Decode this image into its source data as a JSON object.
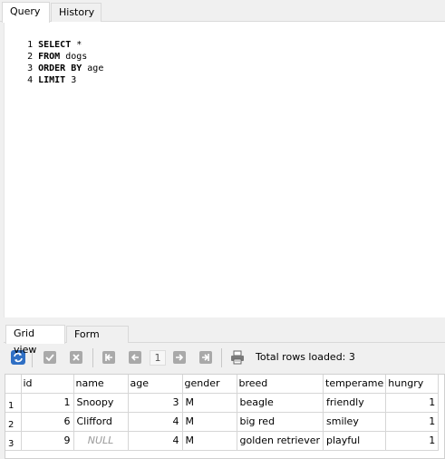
{
  "top_tabs": [
    {
      "label": "Query",
      "active": true
    },
    {
      "label": "History",
      "active": false
    }
  ],
  "editor": {
    "lines": [
      {
        "num": "1",
        "kw": "SELECT",
        "rest": " *"
      },
      {
        "num": "2",
        "kw": "FROM",
        "rest": " dogs"
      },
      {
        "num": "3",
        "kw": "ORDER BY",
        "rest": " age"
      },
      {
        "num": "4",
        "kw": "LIMIT",
        "rest": " 3"
      }
    ]
  },
  "bottom_tabs": [
    {
      "label": "Grid view",
      "active": true
    },
    {
      "label": "Form view",
      "active": false
    }
  ],
  "toolbar": {
    "icons": [
      "refresh-icon",
      "commit-check-icon",
      "rollback-x-icon",
      "first-page-icon",
      "prev-page-icon",
      "next-page-icon",
      "last-page-icon",
      "print-icon"
    ],
    "page": "1",
    "total_label": "Total rows loaded: 3"
  },
  "grid": {
    "columns": [
      "id",
      "name",
      "age",
      "gender",
      "breed",
      "temperame",
      "hungry"
    ],
    "rows": [
      {
        "rn": "1",
        "id": "1",
        "name": "Snoopy",
        "age": "3",
        "gender": "M",
        "breed": "beagle",
        "temperament": "friendly",
        "hungry": "1"
      },
      {
        "rn": "2",
        "id": "6",
        "name": "Clifford",
        "age": "4",
        "gender": "M",
        "breed": "big red",
        "temperament": "smiley",
        "hungry": "1"
      },
      {
        "rn": "3",
        "id": "9",
        "name": "NULL",
        "age": "4",
        "gender": "M",
        "breed": "golden retriever",
        "temperament": "playful",
        "hungry": "1"
      }
    ]
  },
  "colors": {
    "accent_blue": "#2f6fc4",
    "disabled_gray": "#a0a0a0",
    "null_gray": "#999999"
  }
}
